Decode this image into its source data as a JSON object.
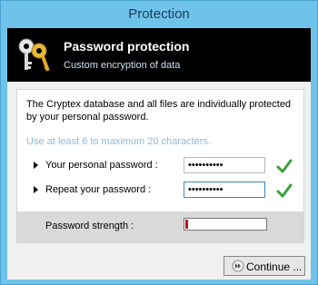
{
  "window": {
    "title": "Protection"
  },
  "header": {
    "title": "Password protection",
    "subtitle": "Custom encryption of data",
    "icon": "keys-icon"
  },
  "panel": {
    "description": "The Cryptex database and all files are individually protected by your personal password.",
    "hint": "Use at least 6 to maximum 20 characters.",
    "fields": [
      {
        "label": "Your personal password :",
        "value": "••••••••••",
        "valid": true
      },
      {
        "label": "Repeat your password :",
        "value": "••••••••••",
        "valid": true
      }
    ],
    "strength": {
      "label": "Password strength :",
      "level": 0.02,
      "color": "#c4131b"
    }
  },
  "footer": {
    "continue_label": "Continue ..."
  },
  "colors": {
    "accent": "#6fc3ea",
    "check": "#3aa03a",
    "hint": "#8fb7d8"
  }
}
